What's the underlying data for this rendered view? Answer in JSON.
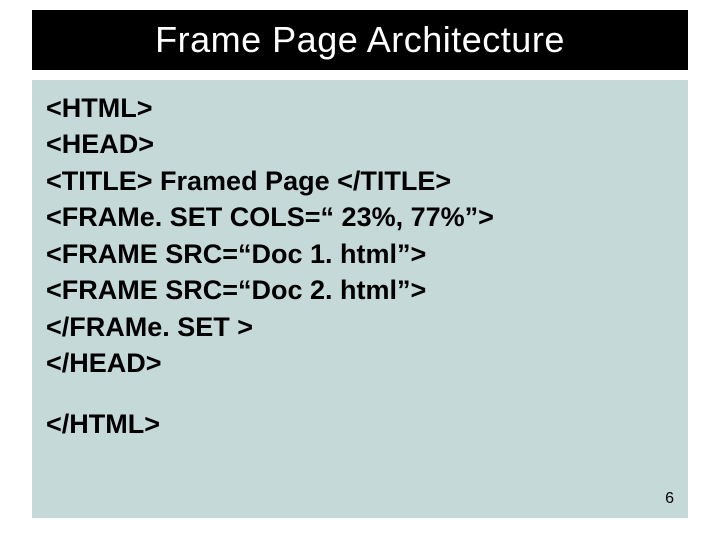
{
  "title": "Frame Page Architecture",
  "code": {
    "l1": "<HTML>",
    "l2": "<HEAD>",
    "l3": "<TITLE> Framed Page </TITLE>",
    "l4": "<FRAMe. SET COLS=“ 23%, 77%”>",
    "l5": "<FRAME SRC=“Doc 1. html”>",
    "l6": "<FRAME SRC=“Doc 2. html”>",
    "l7": "</FRAMe. SET >",
    "l8": "</HEAD>",
    "l9": "</HTML>"
  },
  "page_number": "6"
}
